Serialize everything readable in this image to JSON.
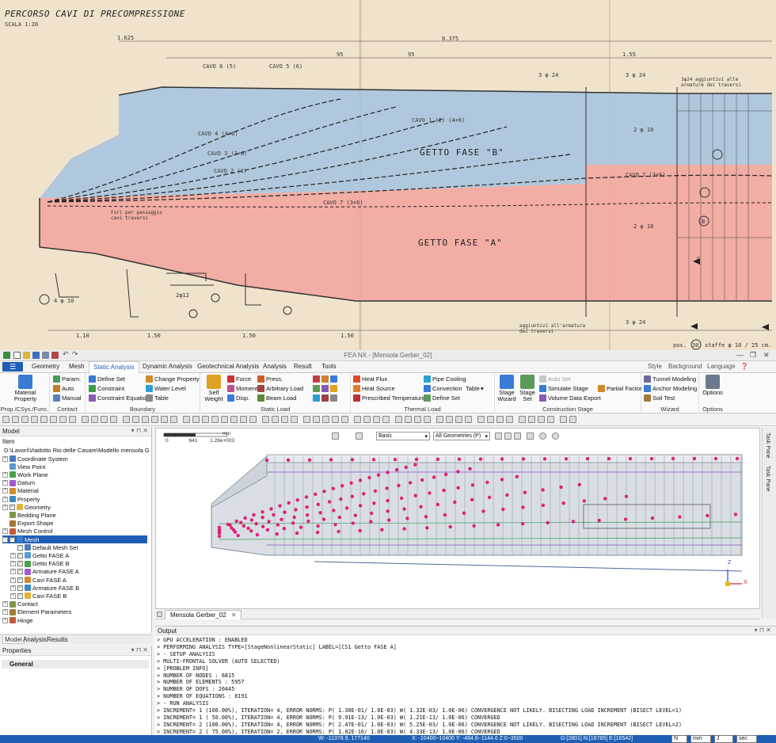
{
  "drawing": {
    "title": "PERCORSO CAVI DI PRECOMPRESSIONE",
    "scale": "SCALA 1:20",
    "phase_b": "GETTO FASE \"B\"",
    "phase_a": "GETTO FASE \"A\"",
    "cables": [
      "CAVO 6 (5)",
      "CAVO 5 (6)",
      "CAVO 4 (4+6)",
      "CAVO 3 (3+6)",
      "CAVO 2 (1)",
      "CAVO 1 (2) (4+6)",
      "CAVO 7 (3+6)",
      "CAVO 7 (3+6)"
    ],
    "note_left": "Fori per passaggio cavi traversi",
    "note_top_right": "3φ24 aggiuntivi alle armature dei traversi",
    "note_bottom_right": "aggiuntivi all'armatura dei traversi",
    "stirrups": "staffe φ 10 / 25 cm.",
    "pos": "pos.",
    "pos_num": "30",
    "section_c": "C",
    "section_b": "B",
    "dim_1625": "1.625",
    "dim_8375": "8.375",
    "dim_95": "95",
    "dim_155": "1.55",
    "dim_110": "1.10",
    "dim_150": "1.50",
    "mark_2d12": "2φ12",
    "mark_4d10": "4 φ 10",
    "mark_3d24": "3 φ 24",
    "mark_2d10": "2 φ 10"
  },
  "window": {
    "title": "FEA NX - [Mensola Gerber_02]",
    "minimize": "—",
    "maximize": "❐",
    "close": "✕"
  },
  "menu": {
    "file": "☰",
    "tabs": [
      "Geometry",
      "Mesh",
      "Static Analysis",
      "Dynamic Analysis",
      "Geotechnical Analysis",
      "Analysis",
      "Result",
      "Tools"
    ],
    "active_tab": "Static Analysis",
    "right": [
      "Style",
      "Background",
      "Language"
    ]
  },
  "ribbon": {
    "groups": {
      "prop": "Prop./CSys./Func.",
      "contact": "Contact",
      "boundary": "Boundary",
      "static_load": "Static Load",
      "thermal_load": "Thermal Load",
      "construction_stage": "Construction Stage",
      "wizard": "Wizard",
      "options": "Options"
    },
    "material_property": "Material Property",
    "contact_items": [
      "Param.",
      "Auto",
      "Manual"
    ],
    "boundary_items": [
      "Define Set",
      "Constraint",
      "Constraint Equation",
      "Change Property",
      "Water Level",
      "Table"
    ],
    "self_weight": "Self Weight",
    "static_items": [
      "Force",
      "Moment",
      "Disp.",
      "Press.",
      "Arbitrary Load",
      "Beam Load"
    ],
    "thermal_items": [
      "Heat Flux",
      "Heat Source",
      "Prescribed Temperature",
      "Pipe Cooling",
      "Convection",
      "Define Set",
      "Table"
    ],
    "stage_wizard": "Stage Wizard",
    "stage_set": "Stage Set",
    "construction_items": [
      "Auto Set",
      "Simulate Stage",
      "Volume Data Export",
      "Partial Factor"
    ],
    "wizard_items": [
      "Tunnel Modeling",
      "Anchor Modeling",
      "Soil Test"
    ],
    "options": "Options"
  },
  "model_panel": {
    "title": "Model",
    "item_header": "Item",
    "path": "D:\\Lavori\\Viadotto Rio delle Casare\\Modello mensola Ge",
    "tree": [
      {
        "label": "Coordinate System",
        "indent": 1,
        "exp": "+"
      },
      {
        "label": "View Point",
        "indent": 1,
        "exp": ""
      },
      {
        "label": "Work Plane",
        "indent": 1,
        "exp": "+"
      },
      {
        "label": "Datum",
        "indent": 1,
        "exp": "+"
      },
      {
        "label": "Material",
        "indent": 1,
        "exp": "+"
      },
      {
        "label": "Property",
        "indent": 1,
        "exp": "+"
      },
      {
        "label": "Geometry",
        "indent": 1,
        "exp": "+"
      },
      {
        "label": "Bedding Plane",
        "indent": 1,
        "exp": ""
      },
      {
        "label": "Export Shape",
        "indent": 1,
        "exp": ""
      },
      {
        "label": "Mesh Control",
        "indent": 1,
        "exp": "+"
      },
      {
        "label": "Mesh",
        "indent": 1,
        "exp": "-",
        "selected": true
      },
      {
        "label": "Default Mesh Set",
        "indent": 2,
        "exp": ""
      },
      {
        "label": "Getto FASE A",
        "indent": 2,
        "exp": "+"
      },
      {
        "label": "Getto FASE B",
        "indent": 2,
        "exp": "+"
      },
      {
        "label": "Armature FASE A",
        "indent": 2,
        "exp": "+"
      },
      {
        "label": "Cavi FASE A",
        "indent": 2,
        "exp": "+"
      },
      {
        "label": "Armature FASE B",
        "indent": 2,
        "exp": "+"
      },
      {
        "label": "Cavi FASE B",
        "indent": 2,
        "exp": "+"
      },
      {
        "label": "Contact",
        "indent": 1,
        "exp": "+"
      },
      {
        "label": "Element Parameters",
        "indent": 1,
        "exp": "+"
      },
      {
        "label": "Hinge",
        "indent": 1,
        "exp": "+"
      }
    ],
    "tabs": [
      "Model",
      "Analysis",
      "Results"
    ]
  },
  "properties_panel": {
    "title": "Properties",
    "section": "General"
  },
  "viewport": {
    "scale_labels": [
      "0",
      "641",
      "1.28e+003"
    ],
    "scale_unit": "mm",
    "view_mode": "Basic",
    "geom_filter": "All Geometries (P)",
    "tab": "Mensola Gerber_02",
    "axis_z": "Z",
    "axis_x": "X"
  },
  "task_pane": [
    "Task Pane",
    "Task Pane"
  ],
  "output": {
    "title": "Output",
    "lines": [
      "> GPU ACCELERATION : ENABLED",
      "> PERFORMING ANALYSIS TYPE=[StageNonlinearStatic] LABEL=[CS1 Getto FASE A]",
      "> - SETUP ANALYSIS",
      ">   MULTI-FRONTAL SOLVER (AUTO SELECTED)",
      ">   [PROBLEM INFO]",
      ">   NUMBER OF NODES       : 6815",
      ">   NUMBER OF ELEMENTS  : 5957",
      ">   NUMBER OF DOFS      : 20445",
      ">   NUMBER OF EQUATIONS : 8191",
      "> - RUN ANALYSIS",
      "> INCREMENT= 1 (100.00%), ITERATION= 4, ERROR NORMS: P( 1.30E-01/ 1.0E-03) W( 1.32E-03/ 1.0E-06) CONVERGENCE NOT LIKELY. BISECTING LOAD INCREMENT (BISECT LEVEL=1)",
      "> INCREMENT= 1 ( 50.00%), ITERATION= 4, ERROR NORMS: P( 9.91E-13/ 1.0E-03) W( 1.21E-13/ 1.0E-06) CONVERGED",
      "> INCREMENT= 2 (100.00%), ITERATION= 4, ERROR NORMS: P( 2.47E-01/ 1.0E-03) W( 5.25E-03/ 1.0E-06) CONVERGENCE NOT LIKELY. BISECTING LOAD INCREMENT (BISECT LEVEL=2)",
      "> INCREMENT= 2 ( 75.00%), ITERATION= 2, ERROR NORMS: P( 1.02E-10/ 1.0E-03) W( 4.33E-13/ 1.0E-06) CONVERGED"
    ]
  },
  "status": {
    "w": "W: -11378.9, 177140",
    "coords": "X: -10400~10400 Y: -464.6~1144.6 Z:0~3500",
    "g": "G:[2801] N:[16785] E:[16542]",
    "unit1": "N",
    "unit2": "mm",
    "unit3": "J",
    "unit4": "sec"
  },
  "colors": {
    "accent": "#1e5fb5",
    "phase_b": "#a9c4df",
    "phase_a": "#f2a6a0",
    "mesh_node": "#e0207a",
    "paper": "#efe3cc"
  }
}
